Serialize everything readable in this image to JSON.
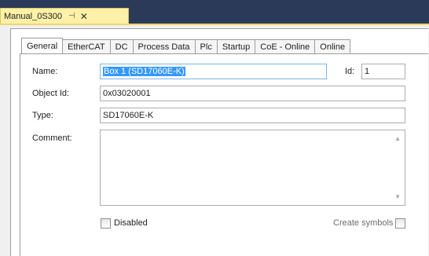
{
  "document_tab": {
    "title": "Manual_0S300",
    "pin_icon": "pin-icon",
    "close_icon": "close-icon"
  },
  "tabs": [
    {
      "label": "General",
      "active": true
    },
    {
      "label": "EtherCAT",
      "active": false
    },
    {
      "label": "DC",
      "active": false
    },
    {
      "label": "Process Data",
      "active": false
    },
    {
      "label": "Plc",
      "active": false
    },
    {
      "label": "Startup",
      "active": false
    },
    {
      "label": "CoE - Online",
      "active": false
    },
    {
      "label": "Online",
      "active": false
    }
  ],
  "form": {
    "name_label": "Name:",
    "name_value": "Box 1 (SD17060E-K)",
    "id_label": "Id:",
    "id_value": "1",
    "object_id_label": "Object Id:",
    "object_id_value": "0x03020001",
    "type_label": "Type:",
    "type_value": "SD17060E-K",
    "comment_label": "Comment:",
    "comment_value": "",
    "disabled_label": "Disabled",
    "disabled_checked": false,
    "create_symbols_label": "Create symbols",
    "create_symbols_checked": false
  },
  "colors": {
    "selection": "#3399ff",
    "doc_tab": "#fff1a8",
    "background": "#2b3a59"
  }
}
